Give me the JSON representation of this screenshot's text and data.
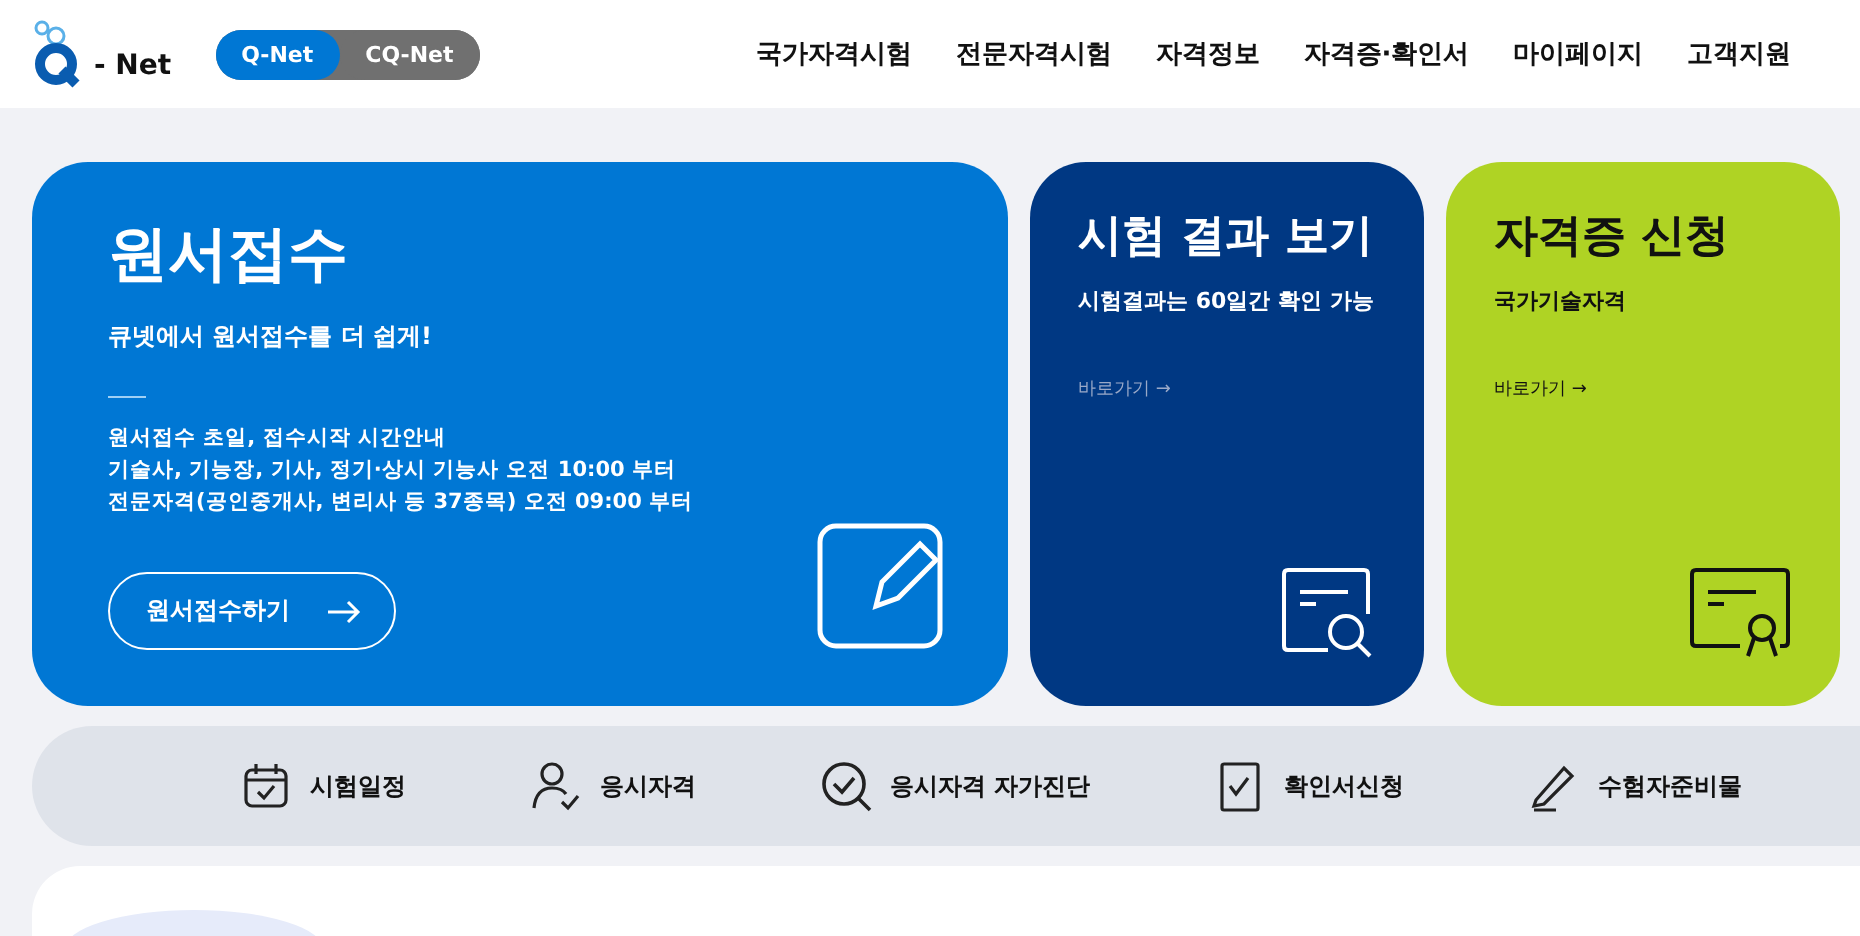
{
  "header": {
    "logo": {
      "text": "- Net"
    },
    "site_tabs": [
      {
        "label": "Q-Net",
        "selected": true
      },
      {
        "label": "CQ-Net",
        "selected": false
      }
    ],
    "nav": [
      "국가자격시험",
      "전문자격시험",
      "자격정보",
      "자격증·확인서",
      "마이페이지",
      "고객지원"
    ]
  },
  "cards": [
    {
      "kind": "main",
      "title": "원서접수",
      "subtitle": "큐넷에서 원서접수를 더 쉽게!",
      "lines": [
        "원서접수 초일, 접수시작 시간안내",
        "기술사, 기능장, 기사, 정기·상시 기능사 오전 10:00 부터",
        "전문자격(공인중개사, 변리사 등 37종목) 오전 09:00 부터"
      ],
      "button": "원서접수하기"
    },
    {
      "kind": "result",
      "title": "시험 결과 보기",
      "subtitle": "시험결과는 60일간 확인 가능",
      "link": "바로가기 →"
    },
    {
      "kind": "license",
      "title": "자격증 신청",
      "subtitle": "국가기술자격",
      "link": "바로가기 →"
    }
  ],
  "quick_links": [
    {
      "kind": "calendar",
      "label": "시험일정"
    },
    {
      "kind": "person",
      "label": "응시자격"
    },
    {
      "kind": "check-search",
      "label": "응시자격 자가진단"
    },
    {
      "kind": "document",
      "label": "확인서신청"
    },
    {
      "kind": "pencil",
      "label": "수험자준비물"
    }
  ]
}
